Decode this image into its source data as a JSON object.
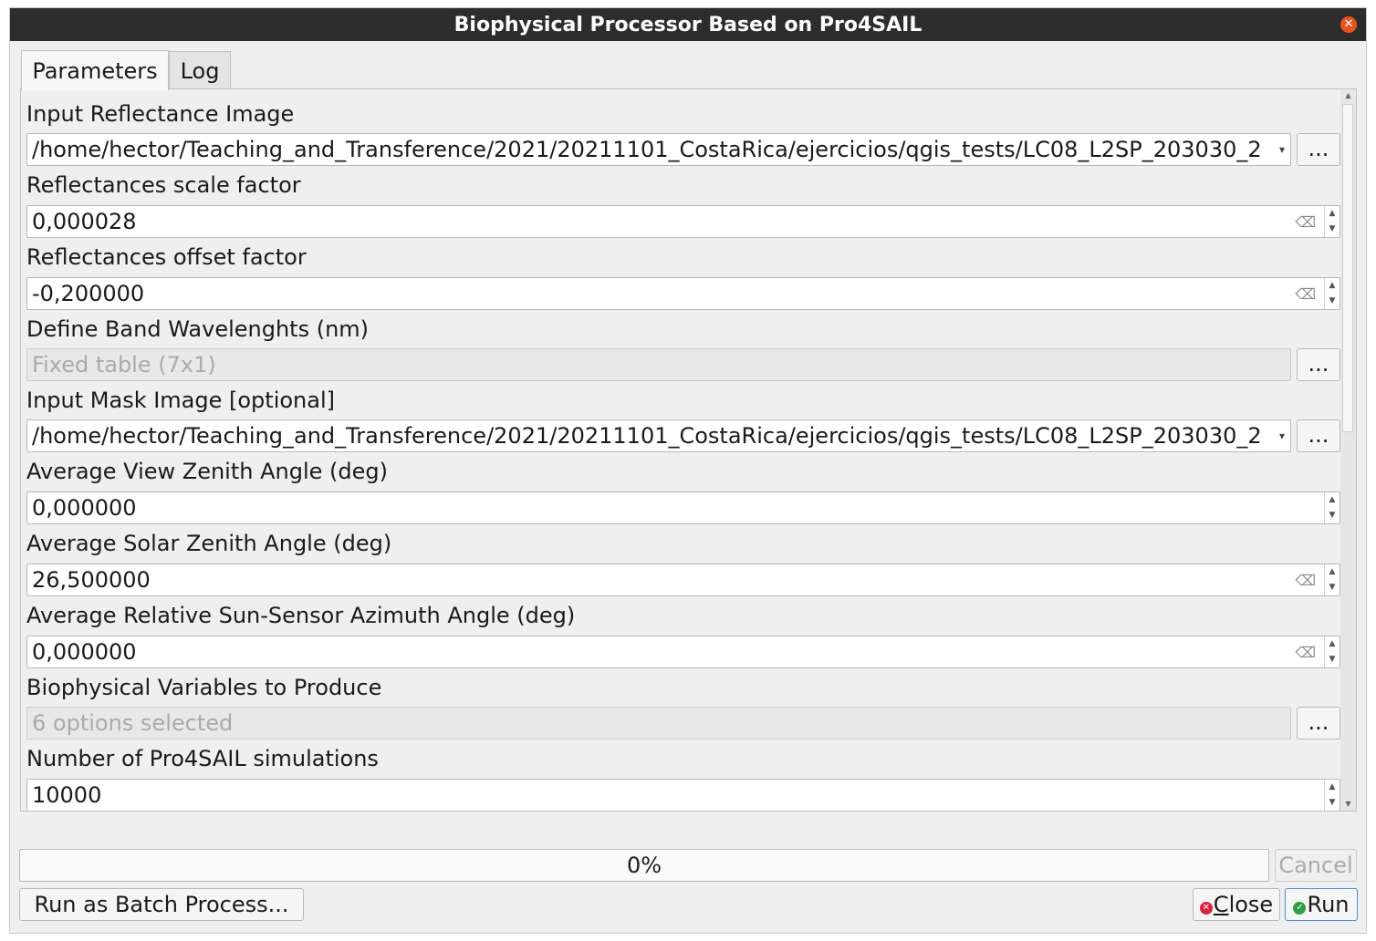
{
  "window": {
    "title": "Biophysical Processor Based on Pro4SAIL"
  },
  "tabs": [
    {
      "label": "Parameters",
      "active": true
    },
    {
      "label": "Log",
      "active": false
    }
  ],
  "params": {
    "input_reflectance": {
      "label": "Input Reflectance Image",
      "value": "/home/hector/Teaching_and_Transference/2021/20211101_CostaRica/ejercicios/qgis_tests/LC08_L2SP_203030_2",
      "browse": "..."
    },
    "scale_factor": {
      "label": "Reflectances scale factor",
      "value": "0,000028"
    },
    "offset_factor": {
      "label": "Reflectances offset factor",
      "value": "-0,200000"
    },
    "band_wavelengths": {
      "label": "Define Band Wavelenghts (nm)",
      "value": "Fixed table (7x1)",
      "browse": "..."
    },
    "input_mask": {
      "label": "Input Mask Image [optional]",
      "value": "/home/hector/Teaching_and_Transference/2021/20211101_CostaRica/ejercicios/qgis_tests/LC08_L2SP_203030_2",
      "browse": "..."
    },
    "view_zenith": {
      "label": "Average View Zenith Angle (deg)",
      "value": "0,000000"
    },
    "solar_zenith": {
      "label": "Average Solar Zenith Angle (deg)",
      "value": "26,500000"
    },
    "relative_azimuth": {
      "label": "Average Relative Sun-Sensor Azimuth Angle (deg)",
      "value": "0,000000"
    },
    "biophysical_vars": {
      "label": "Biophysical Variables to Produce",
      "value": "6 options selected",
      "browse": "..."
    },
    "simulations": {
      "label": "Number of Pro4SAIL simulations",
      "value": "10000"
    }
  },
  "progress": {
    "text": "0%",
    "value": 0
  },
  "buttons": {
    "cancel": "Cancel",
    "batch": "Run as Batch Process...",
    "close_prefix": "",
    "close_mnemonic": "C",
    "close_rest": "lose",
    "run": "Run"
  },
  "icons": {
    "window_close": "close-circle-icon",
    "combo": "chevron-down-icon",
    "clear": "backspace-clear-icon",
    "spin": "spin-arrows-icon",
    "close_button": "red-x-circle-icon",
    "run_button": "green-check-circle-icon"
  },
  "colors": {
    "titlebar": "#2d2d2d",
    "close_accent": "#e95420",
    "run_icon": "#2f9e44",
    "close_icon": "#d9223a"
  }
}
